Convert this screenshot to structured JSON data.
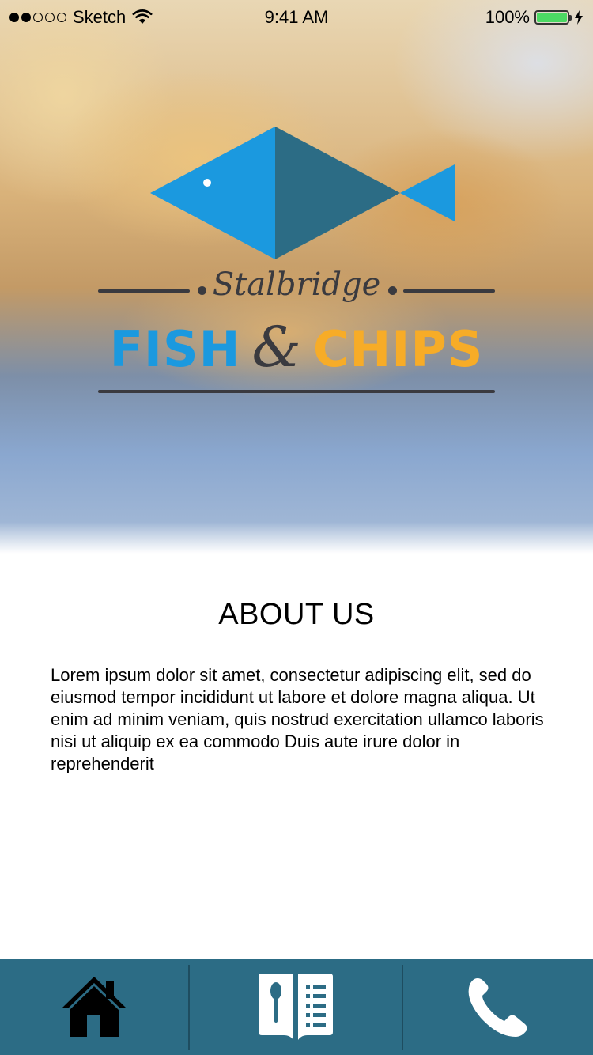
{
  "status_bar": {
    "signal_dots": 5,
    "signal_filled": 2,
    "carrier": "Sketch",
    "time": "9:41 AM",
    "battery_percent": "100%",
    "battery_level": 1.0,
    "icons": [
      "wifi-icon",
      "battery-icon",
      "charging-bolt-icon"
    ]
  },
  "hero": {
    "logo": {
      "script_name": "Stalbridge",
      "word_fish": "FISH",
      "ampersand": "&",
      "word_chips": "CHIPS"
    }
  },
  "about": {
    "title": "ABOUT US",
    "body": "Lorem ipsum dolor sit amet, consectetur adipiscing elit, sed do eiusmod tempor incididunt ut labore et dolore magna aliqua. Ut enim ad minim veniam, quis nostrud exercitation ullamco laboris nisi ut aliquip ex ea commodo Duis aute irure dolor in reprehenderit"
  },
  "tab_bar": {
    "tabs": [
      {
        "icon": "home-icon"
      },
      {
        "icon": "menu-book-icon"
      },
      {
        "icon": "phone-icon"
      }
    ]
  },
  "colors": {
    "fish_blue": "#1b99df",
    "fish_dark": "#2c6c85",
    "chips_orange": "#f7ac27",
    "logo_text": "#3a3a3f",
    "tab_bar_bg": "#2c6c85"
  }
}
